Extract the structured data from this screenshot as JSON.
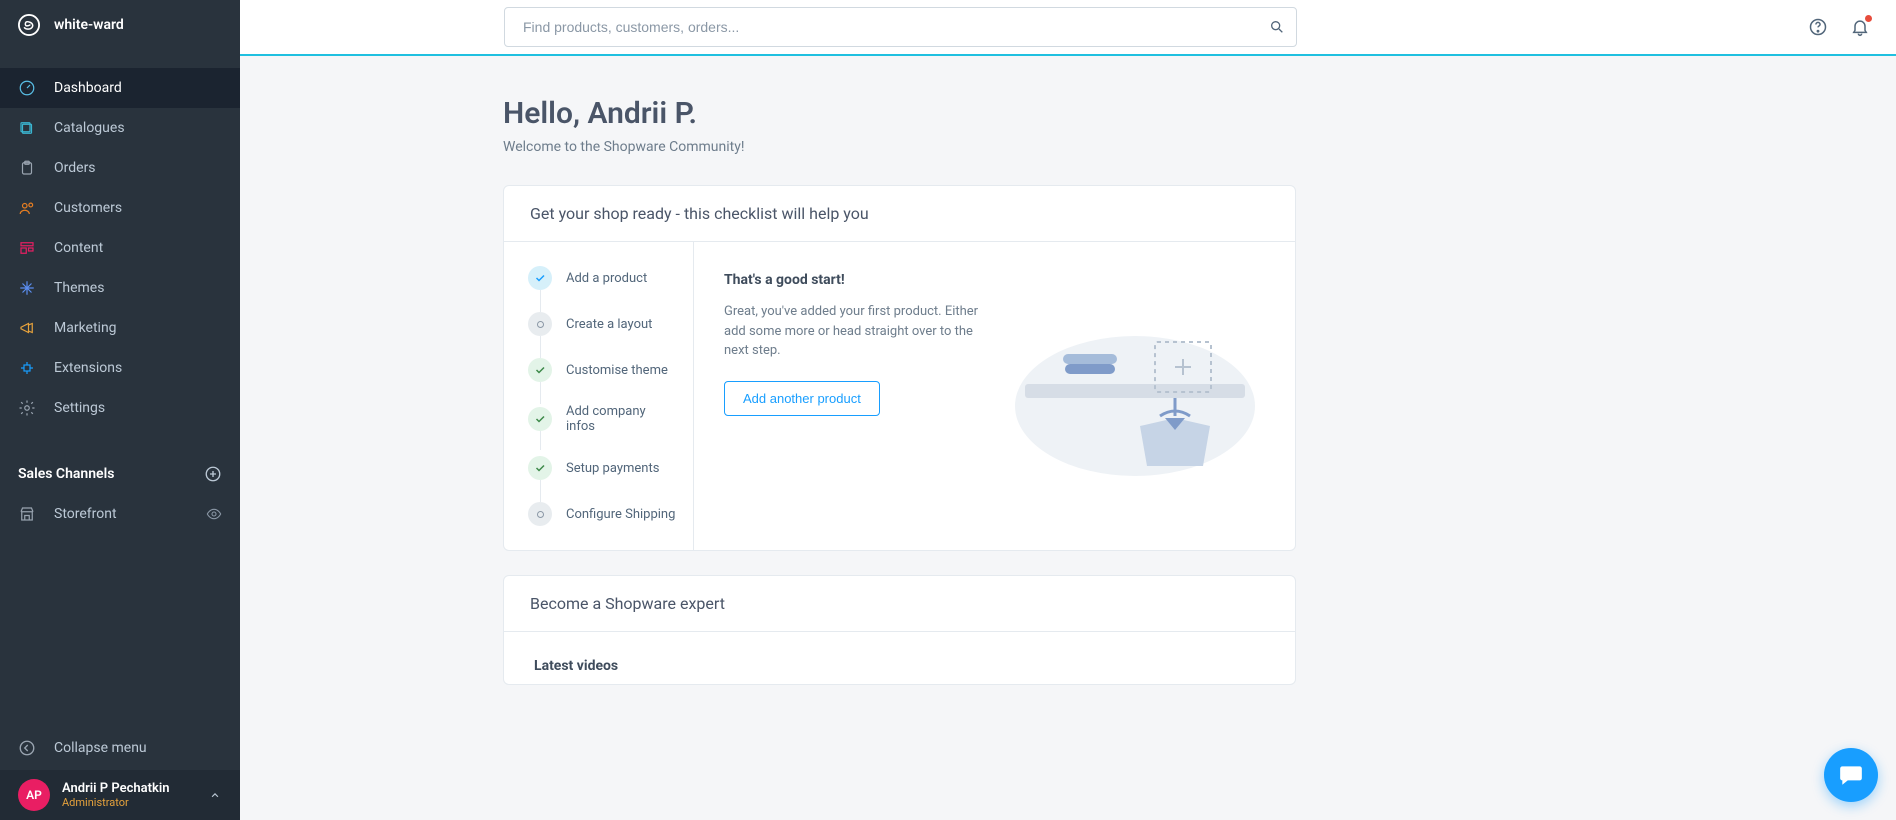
{
  "brand": "white-ward",
  "search": {
    "placeholder": "Find products, customers, orders..."
  },
  "nav": {
    "dashboard": "Dashboard",
    "catalogues": "Catalogues",
    "orders": "Orders",
    "customers": "Customers",
    "content": "Content",
    "themes": "Themes",
    "marketing": "Marketing",
    "extensions": "Extensions",
    "settings": "Settings"
  },
  "sales_channels": {
    "heading": "Sales Channels",
    "storefront": "Storefront"
  },
  "collapse": "Collapse menu",
  "user": {
    "initials": "AP",
    "name": "Andrii P Pechatkin",
    "role": "Administrator"
  },
  "greeting": {
    "title": "Hello, Andrii P.",
    "subtitle": "Welcome to the Shopware Community!"
  },
  "checklist": {
    "card_title": "Get your shop ready - this checklist will help you",
    "items": {
      "add_product": "Add a product",
      "create_layout": "Create a layout",
      "customise_theme": "Customise theme",
      "company_infos": "Add company infos",
      "setup_payments": "Setup payments",
      "configure_shipping": "Configure Shipping"
    },
    "detail": {
      "title": "That's a good start!",
      "desc": "Great, you've added your first product. Either add some more or head straight over to the next step.",
      "button": "Add another product"
    }
  },
  "expert": {
    "title": "Become a Shopware expert",
    "latest_videos": "Latest videos"
  },
  "colors": {
    "accent": "#189eff",
    "sidebar": "#29333d",
    "sidebar_active": "#1b2430"
  }
}
